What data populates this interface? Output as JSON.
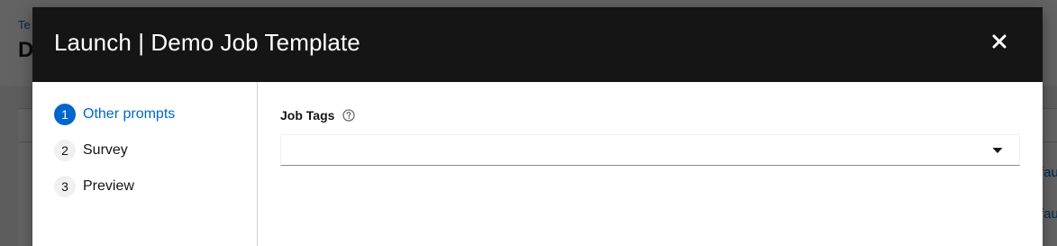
{
  "background": {
    "breadcrumb": "Te",
    "title": "D",
    "links": [
      "fau",
      "fau"
    ]
  },
  "modal": {
    "title": "Launch | Demo Job Template",
    "close_icon": "close-icon"
  },
  "wizard": {
    "steps": [
      {
        "number": "1",
        "label": "Other prompts",
        "active": true
      },
      {
        "number": "2",
        "label": "Survey",
        "active": false
      },
      {
        "number": "3",
        "label": "Preview",
        "active": false
      }
    ]
  },
  "form": {
    "job_tags_label": "Job Tags",
    "job_tags_help_icon": "question-circle-icon",
    "job_tags_value": "",
    "caret_icon": "caret-down-icon"
  },
  "colors": {
    "accent": "#0066cc",
    "header_bg": "#151515",
    "overlay": "#4f4f4f"
  }
}
